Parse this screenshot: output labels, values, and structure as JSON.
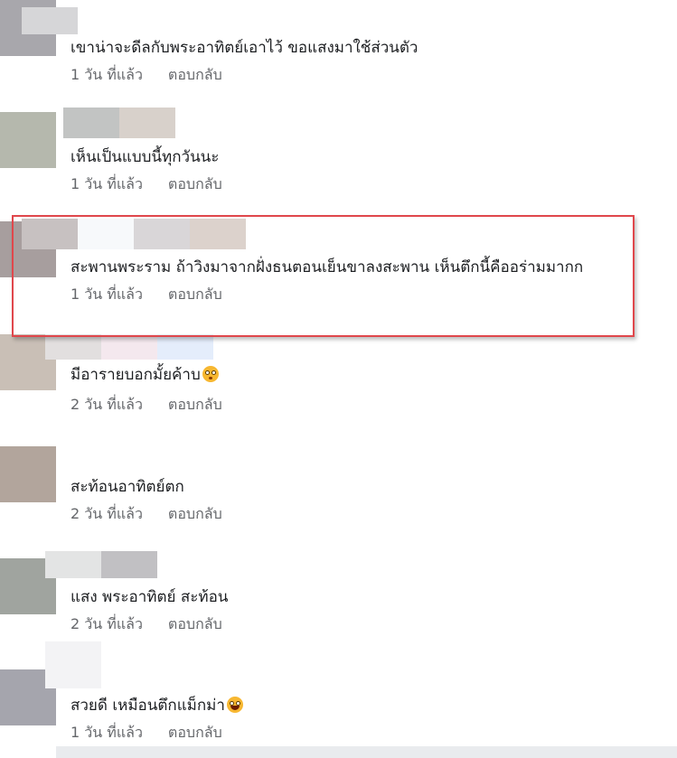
{
  "comments": [
    {
      "text": "เขาน่าจะดีลกับพระอาทิตย์เอาไว้ ขอแสงมาใช้ส่วนตัว",
      "time": "1 วัน ที่แล้ว",
      "reply": "ตอบกลับ",
      "emoji": ""
    },
    {
      "text": "เห็นเป็นแบบนี้ทุกวันนะ",
      "time": "1 วัน ที่แล้ว",
      "reply": "ตอบกลับ",
      "emoji": ""
    },
    {
      "text": "สะพานพระราม ถ้าวิงมาจากฝั่งธนตอนเย็นขาลงสะพาน เห็นตึกนี้คืออร่ามมากก",
      "time": "1 วัน ที่แล้ว",
      "reply": "ตอบกลับ",
      "emoji": ""
    },
    {
      "text": "มีอารายบอกมั้ยค้าบ",
      "time": "2 วัน ที่แล้ว",
      "reply": "ตอบกลับ",
      "emoji": "flushed-face-icon"
    },
    {
      "text": "สะท้อนอาทิตย์ตก",
      "time": "2 วัน ที่แล้ว",
      "reply": "ตอบกลับ",
      "emoji": ""
    },
    {
      "text": "แสง พระอาทิตย์ สะท้อน",
      "time": "2 วัน ที่แล้ว",
      "reply": "ตอบกลับ",
      "emoji": ""
    },
    {
      "text": "สวยดี เหมือนตึกแม็กม่า",
      "time": "1 วัน ที่แล้ว",
      "reply": "ตอบกลับ",
      "emoji": "laughing-face-icon"
    }
  ],
  "highlight_color": "#e0474c",
  "text_color": "#1c1e21",
  "meta_color": "#65676b"
}
